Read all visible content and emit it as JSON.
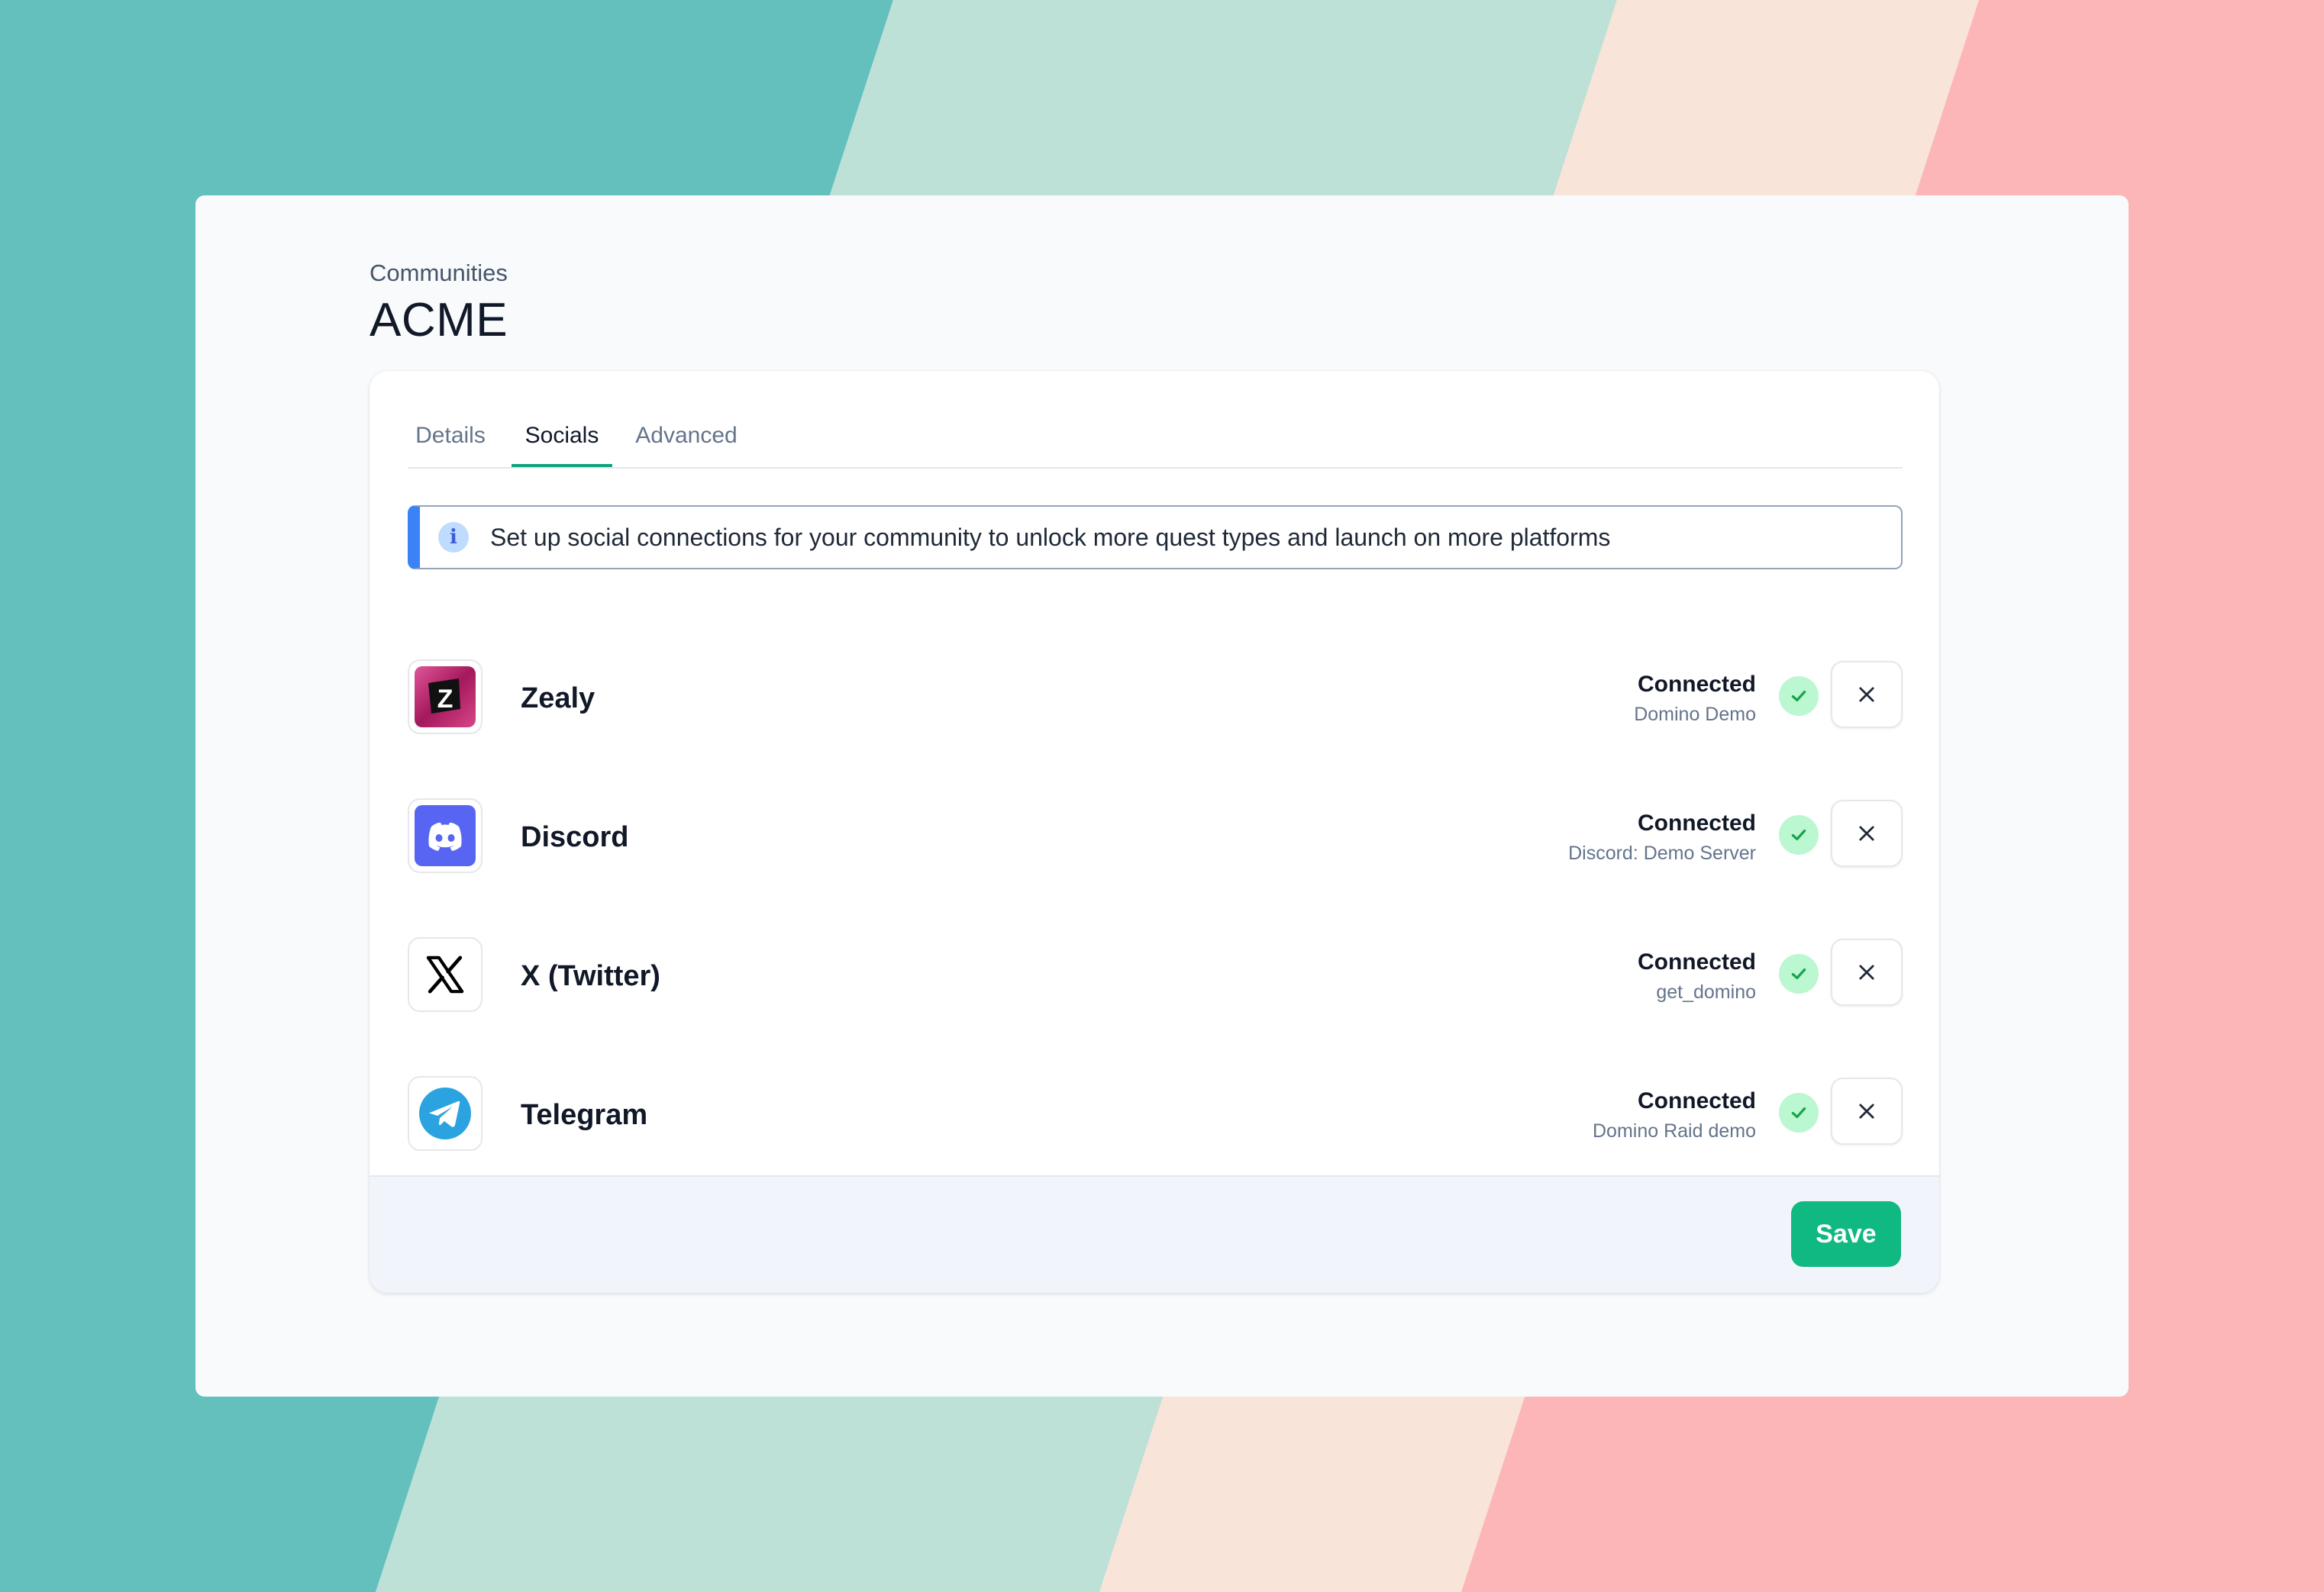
{
  "colors": {
    "background_stripes": [
      "#64c0bd",
      "#bde0d7",
      "#f8e4d8",
      "#fcb6b8"
    ],
    "accent": "#10a37f",
    "save_button": "#10b981",
    "info": "#3b82f6",
    "connected": "#22c55e"
  },
  "header": {
    "breadcrumb": "Communities",
    "title": "ACME"
  },
  "tabs": [
    {
      "label": "Details",
      "active": false
    },
    {
      "label": "Socials",
      "active": true
    },
    {
      "label": "Advanced",
      "active": false
    }
  ],
  "alert": {
    "icon": "info-icon",
    "text": "Set up social connections for your community to unlock more quest types and launch on more platforms"
  },
  "socials": [
    {
      "name": "Zealy",
      "icon": "zealy-logo-icon",
      "status": "Connected",
      "account": "Domino Demo"
    },
    {
      "name": "Discord",
      "icon": "discord-logo-icon",
      "status": "Connected",
      "account": "Discord: Demo Server"
    },
    {
      "name": "X (Twitter)",
      "icon": "x-logo-icon",
      "status": "Connected",
      "account": "get_domino"
    },
    {
      "name": "Telegram",
      "icon": "telegram-logo-icon",
      "status": "Connected",
      "account": "Domino Raid demo"
    }
  ],
  "footer": {
    "save_label": "Save"
  }
}
